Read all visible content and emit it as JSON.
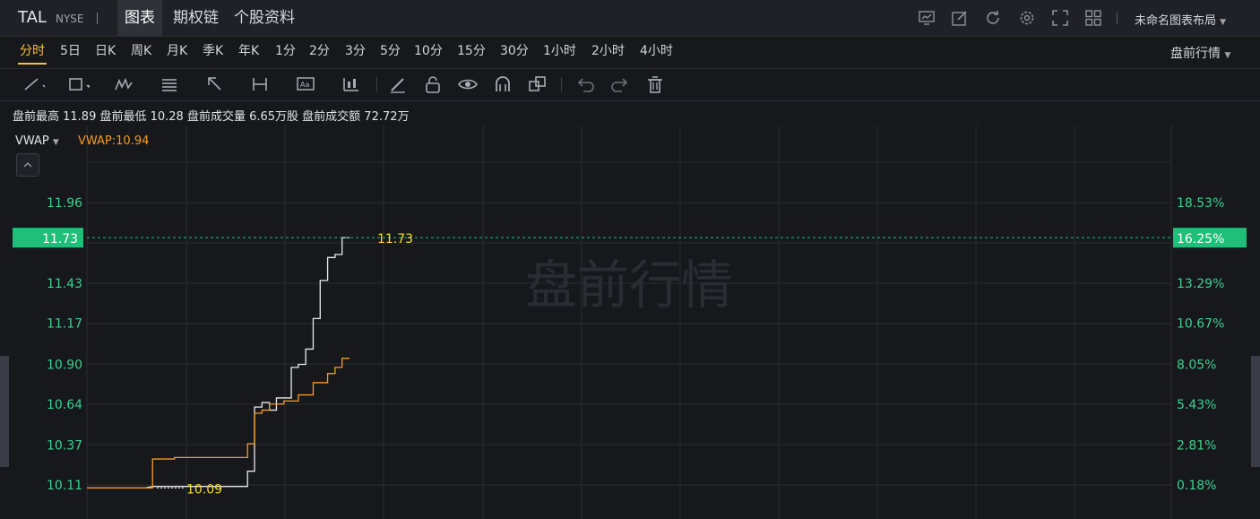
{
  "header": {
    "symbol": "TAL",
    "exchange": "NYSE",
    "tabs": [
      {
        "label": "图表",
        "active": true
      },
      {
        "label": "期权链",
        "active": false
      },
      {
        "label": "个股资料",
        "active": false
      }
    ],
    "toolbar_icons": [
      "chart-settings-icon",
      "edit-icon",
      "refresh-icon",
      "gear-icon",
      "fullscreen-icon",
      "grid-layout-icon"
    ],
    "layout_selector": "未命名图表布局"
  },
  "periods": {
    "items": [
      "分时",
      "5日",
      "日K",
      "周K",
      "月K",
      "季K",
      "年K",
      "1分",
      "2分",
      "3分",
      "5分",
      "10分",
      "15分",
      "30分",
      "1小时",
      "2小时",
      "4小时"
    ],
    "active": "分时",
    "session_selector": "盘前行情"
  },
  "drawing_tools": [
    "trendline-icon",
    "rectangle-icon",
    "pattern-icon",
    "fib-icon",
    "arrow-icon",
    "measure-icon",
    "text-icon",
    "indicator-icon",
    "pencil-icon",
    "lock-icon",
    "eye-icon",
    "magnet-icon",
    "layers-icon",
    "undo-icon",
    "redo-icon",
    "trash-icon"
  ],
  "stats": "盘前最高 11.89 盘前最低 10.28 盘前成交量 6.65万股 盘前成交额 72.72万",
  "indicator": {
    "name": "VWAP",
    "value_text": "VWAP:10.94"
  },
  "watermark": "盘前行情",
  "colors": {
    "up": "#1fbf7a",
    "price_line": "#e8e9ec",
    "vwap_line": "#f59a23",
    "label_yellow": "#f5d83a"
  },
  "current": {
    "price": "11.73",
    "percent": "16.25%",
    "line_label": "11.73"
  },
  "start_label": "10.09",
  "chart_data": {
    "type": "line",
    "y_ticks": [
      "11.96",
      "11.43",
      "11.17",
      "10.90",
      "10.64",
      "10.37",
      "10.11"
    ],
    "pct_ticks": [
      "18.53%",
      "13.29%",
      "10.67%",
      "8.05%",
      "5.43%",
      "2.81%",
      "0.18%"
    ],
    "ylim": [
      10.05,
      12.25
    ],
    "x_range": [
      0,
      1000
    ],
    "series": [
      {
        "values_x": [
          0,
          133,
          133,
          150,
          150,
          200,
          200,
          367,
          367,
          383,
          383,
          400,
          400,
          417,
          417,
          433,
          433,
          450,
          450,
          467,
          467,
          483,
          483,
          500,
          500,
          517,
          517,
          533,
          533,
          550,
          550,
          567,
          567,
          583,
          583,
          600
        ],
        "values_y": [
          10.09,
          10.09,
          10.09,
          10.1,
          10.1,
          10.1,
          10.1,
          10.1,
          10.2,
          10.2,
          10.62,
          10.62,
          10.65,
          10.65,
          10.6,
          10.6,
          10.68,
          10.68,
          10.68,
          10.68,
          10.88,
          10.88,
          10.9,
          10.9,
          11.0,
          11.0,
          11.2,
          11.2,
          11.45,
          11.45,
          11.6,
          11.6,
          11.62,
          11.62,
          11.73,
          11.73
        ]
      },
      {
        "values_x": [
          0,
          133,
          133,
          150,
          150,
          200,
          200,
          367,
          367,
          383,
          383,
          400,
          400,
          417,
          417,
          450,
          450,
          483,
          483,
          517,
          517,
          550,
          550,
          567,
          567,
          583,
          583,
          600
        ],
        "values_y": [
          10.09,
          10.09,
          10.09,
          10.09,
          10.28,
          10.28,
          10.29,
          10.29,
          10.38,
          10.38,
          10.58,
          10.58,
          10.6,
          10.6,
          10.64,
          10.64,
          10.66,
          10.66,
          10.7,
          10.7,
          10.78,
          10.78,
          10.84,
          10.84,
          10.88,
          10.88,
          10.94,
          10.94
        ]
      }
    ]
  }
}
